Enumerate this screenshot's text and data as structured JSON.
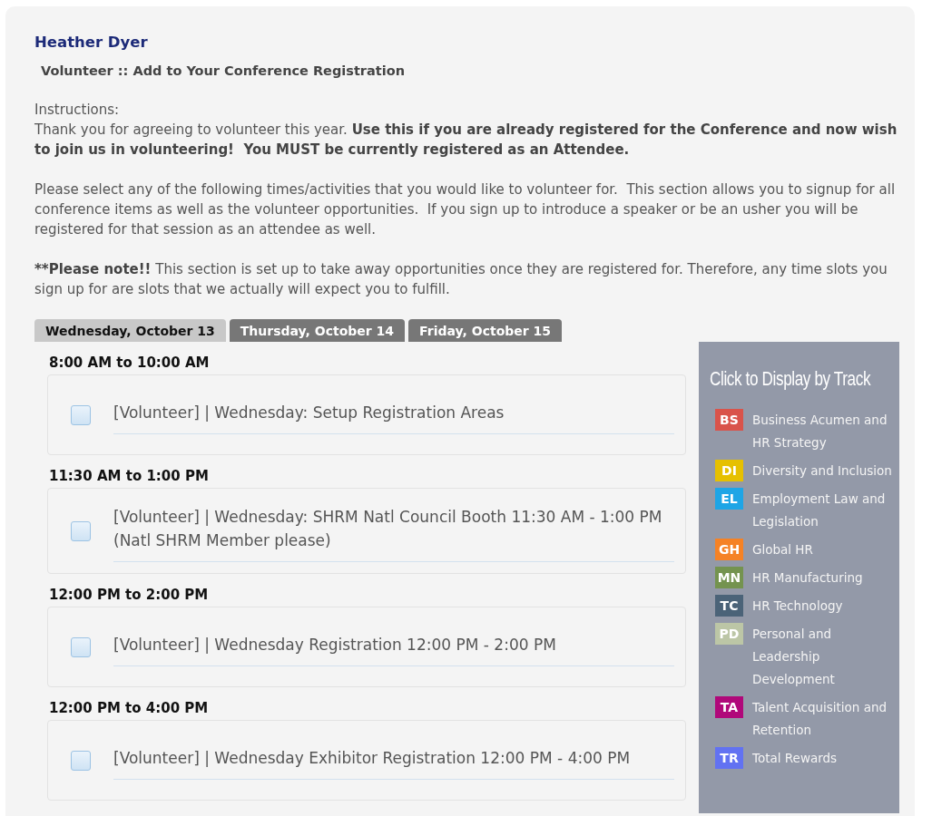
{
  "user_name": "Heather Dyer",
  "page_title": "Volunteer :: Add to Your Conference Registration",
  "instructions_label": "Instructions:",
  "paragraphs": [
    "Thank you for agreeing to volunteer this year. **Use this if you are already registered for the Conference and now wish to join us in volunteering!  You MUST be currently registered as an Attendee.**",
    "Please select any of the following times/activities that you would like to volunteer for.  This section allows you to signup for all conference items as well as the volunteer opportunities.  If you sign up to introduce a speaker or be an usher you will be registered for that session as an attendee as well.",
    "****Please note!!** This section is set up to take away opportunities once they are registered for. Therefore, any time slots you sign up for are slots that we actually will expect you to fulfill."
  ],
  "tabs": [
    {
      "label": "Wednesday, October 13",
      "selected": true
    },
    {
      "label": "Thursday, October 14",
      "selected": false
    },
    {
      "label": "Friday, October 15",
      "selected": false
    }
  ],
  "sessions": [
    {
      "time": "8:00 AM to 10:00 AM",
      "label": "[Volunteer] | Wednesday: Setup Registration Areas",
      "checked": false
    },
    {
      "time": "11:30 AM to 1:00 PM",
      "label": "[Volunteer] | Wednesday: SHRM Natl Council Booth 11:30 AM - 1:00 PM (Natl SHRM Member please)",
      "checked": false
    },
    {
      "time": "12:00 PM to 2:00 PM",
      "label": "[Volunteer] | Wednesday Registration 12:00 PM - 2:00 PM",
      "checked": false
    },
    {
      "time": "12:00 PM to 4:00 PM",
      "label": "[Volunteer] | Wednesday Exhibitor Registration 12:00 PM - 4:00 PM",
      "checked": false
    }
  ],
  "track_panel": {
    "title": "Click to Display by Track",
    "tracks": [
      {
        "code": "BS",
        "label": "Business Acumen and HR Strategy",
        "color": "#d9534a"
      },
      {
        "code": "DI",
        "label": "Diversity and Inclusion",
        "color": "#e6c000"
      },
      {
        "code": "EL",
        "label": "Employment Law and Legislation",
        "color": "#1ea5e6"
      },
      {
        "code": "GH",
        "label": "Global HR",
        "color": "#f58225"
      },
      {
        "code": "MN",
        "label": "HR Manufacturing",
        "color": "#74934f"
      },
      {
        "code": "TC",
        "label": "HR Technology",
        "color": "#4b6378"
      },
      {
        "code": "PD",
        "label": "Personal and Leadership Development",
        "color": "#bcc6a6"
      },
      {
        "code": "TA",
        "label": "Talent Acquisition and Retention",
        "color": "#b0087a"
      },
      {
        "code": "TR",
        "label": "Total Rewards",
        "color": "#6272f2"
      }
    ]
  }
}
